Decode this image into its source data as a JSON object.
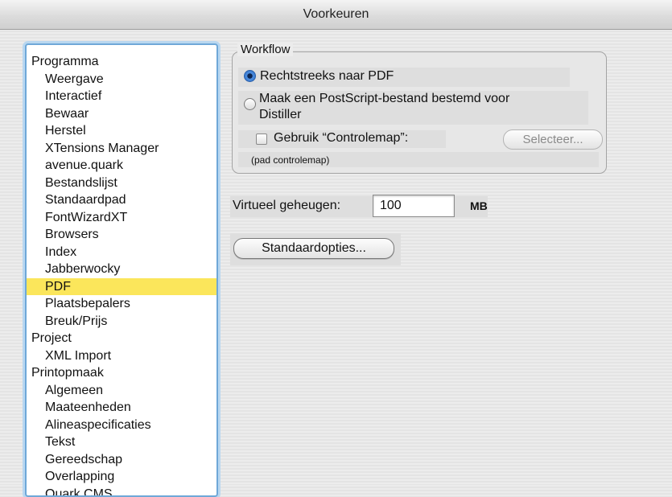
{
  "window": {
    "title": "Voorkeuren"
  },
  "sidebar": {
    "items": [
      {
        "label": "Programma",
        "level": 0
      },
      {
        "label": "Weergave",
        "level": 1
      },
      {
        "label": "Interactief",
        "level": 1
      },
      {
        "label": "Bewaar",
        "level": 1
      },
      {
        "label": "Herstel",
        "level": 1
      },
      {
        "label": "XTensions Manager",
        "level": 1
      },
      {
        "label": "avenue.quark",
        "level": 1
      },
      {
        "label": "Bestandslijst",
        "level": 1
      },
      {
        "label": "Standaardpad",
        "level": 1
      },
      {
        "label": "FontWizardXT",
        "level": 1
      },
      {
        "label": "Browsers",
        "level": 1
      },
      {
        "label": "Index",
        "level": 1
      },
      {
        "label": "Jabberwocky",
        "level": 1
      },
      {
        "label": "PDF",
        "level": 1,
        "selected": true
      },
      {
        "label": "Plaatsbepalers",
        "level": 1
      },
      {
        "label": "Breuk/Prijs",
        "level": 1
      },
      {
        "label": "Project",
        "level": 0
      },
      {
        "label": "XML Import",
        "level": 1
      },
      {
        "label": "Printopmaak",
        "level": 0
      },
      {
        "label": "Algemeen",
        "level": 1
      },
      {
        "label": "Maateenheden",
        "level": 1
      },
      {
        "label": "Alineaspecificaties",
        "level": 1
      },
      {
        "label": "Tekst",
        "level": 1
      },
      {
        "label": "Gereedschap",
        "level": 1
      },
      {
        "label": "Overlapping",
        "level": 1
      },
      {
        "label": "Quark CMS",
        "level": 1
      }
    ],
    "selected_color": "#fbe65b"
  },
  "workflow": {
    "title": "Workflow",
    "radio_direct_label": "Rechtstreeks naar PDF",
    "radio_postscript_line1": "Maak een PostScript-bestand bestemd voor",
    "radio_postscript_line2": "Distiller",
    "selected_option": "Rechtstreeks naar PDF",
    "checkbox_label": "Gebruik “Controlemap”:",
    "checkbox_checked": false,
    "select_button": "Selecteer...",
    "path_label": "(pad controlemap)"
  },
  "memory": {
    "label": "Virtueel geheugen:",
    "value": "100",
    "unit": "MB"
  },
  "defaults_button": "Standaardopties..."
}
